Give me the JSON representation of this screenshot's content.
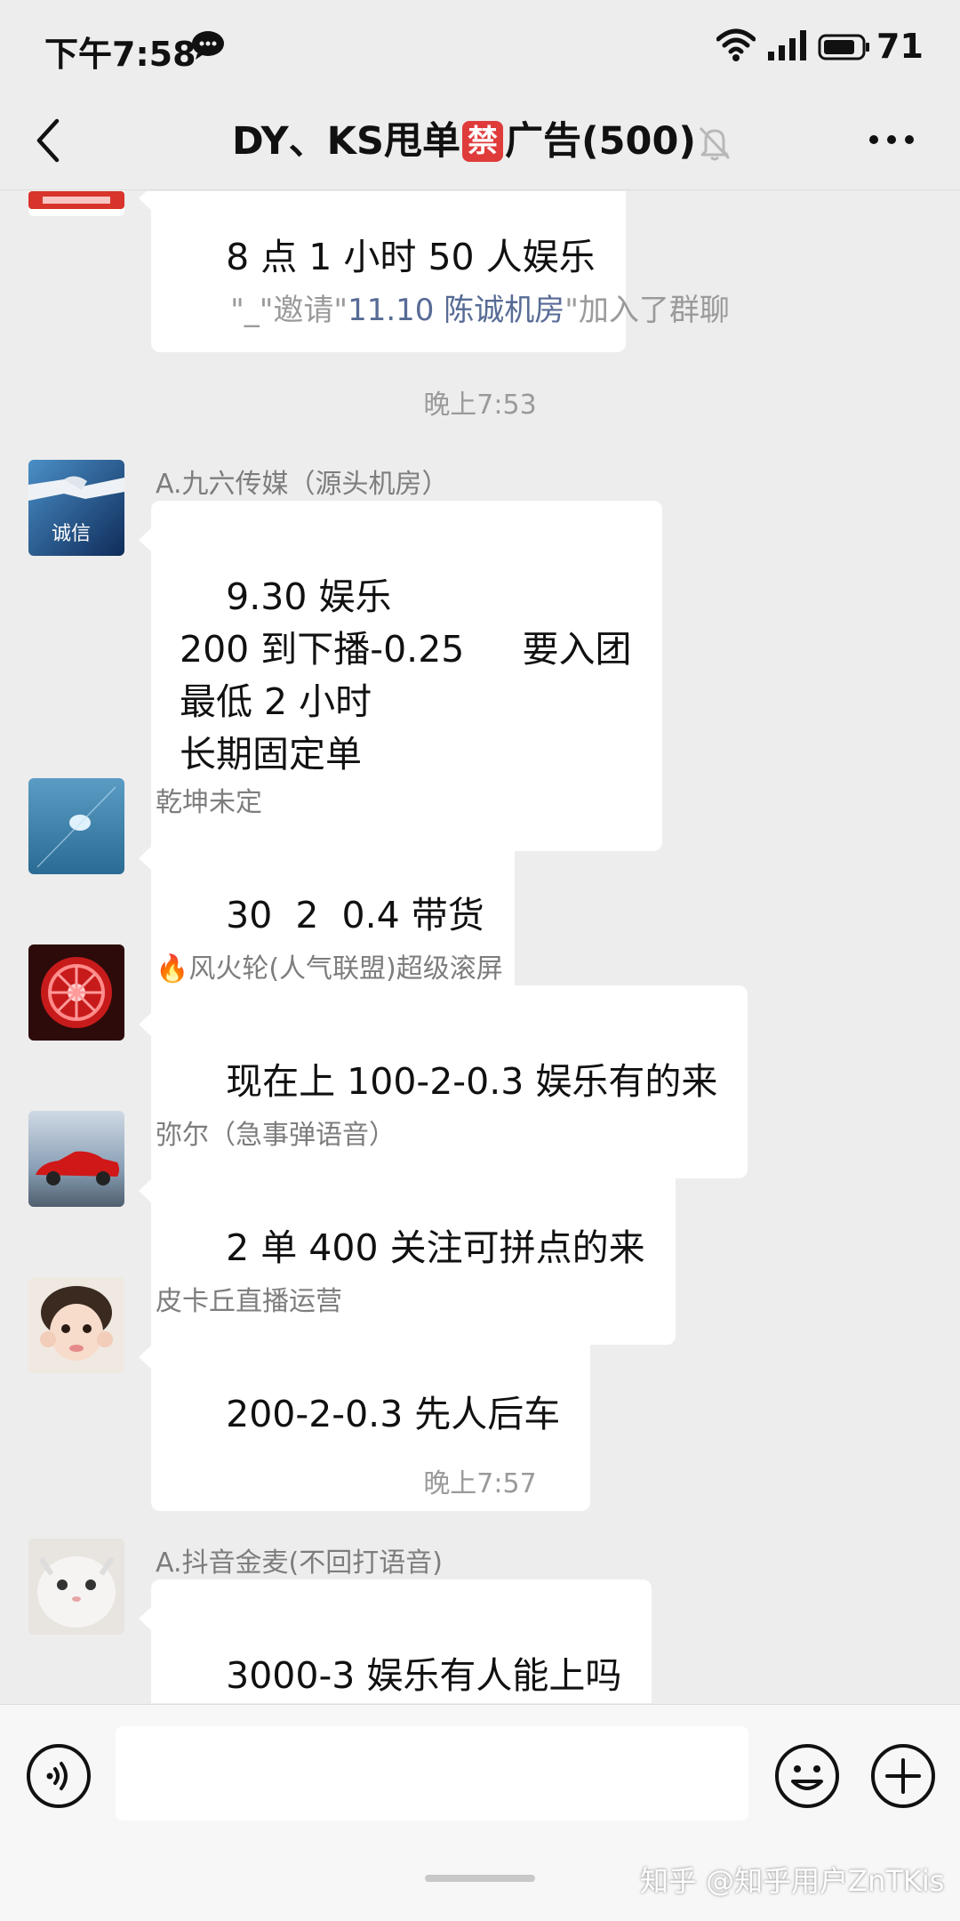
{
  "status_bar": {
    "time": "下午7:58",
    "battery": "71"
  },
  "nav": {
    "title_prefix": "DY、KS甩单",
    "ban_char": "禁",
    "title_suffix": "广告(500)"
  },
  "chat": {
    "partial_message": "8 点 1 小时 50 人娱乐",
    "system_message": {
      "inviter": "\"_\"邀请\"",
      "invitee": "11.10 陈诚机房",
      "suffix": "\"加入了群聊"
    },
    "timestamp_1": "晚上7:53",
    "timestamp_2": "晚上7:57",
    "messages": [
      {
        "sender": "A.九六传媒（源头机房）",
        "text": "9.30 娱乐\n200 到下播-0.25     要入团\n最低 2 小时\n长期固定单",
        "avatar": "handshake-avatar"
      },
      {
        "sender": "乾坤未定",
        "text": "30  2  0.4 带货",
        "avatar": "sea-avatar"
      },
      {
        "sender": "🔥风火轮(人气联盟)超级滚屏",
        "text": "现在上 100-2-0.3 娱乐有的来",
        "avatar": "wheel-avatar"
      },
      {
        "sender": "弥尔（急事弹语音）",
        "text": "2 单 400 关注可拼点的来",
        "avatar": "car-avatar"
      },
      {
        "sender": "皮卡丘直播运营",
        "text": "200-2-0.3 先人后车",
        "avatar": "child-avatar"
      },
      {
        "sender": "A.抖音金麦(不回打语音)",
        "text": "3000-3 娱乐有人能上吗",
        "avatar": "cat-avatar"
      }
    ]
  },
  "watermark": "知乎 @知乎用户ZnTKis",
  "colors": {
    "background": "#ededed",
    "bubble": "#ffffff",
    "link": "#576b95",
    "ban_badge": "#e03b3b"
  }
}
